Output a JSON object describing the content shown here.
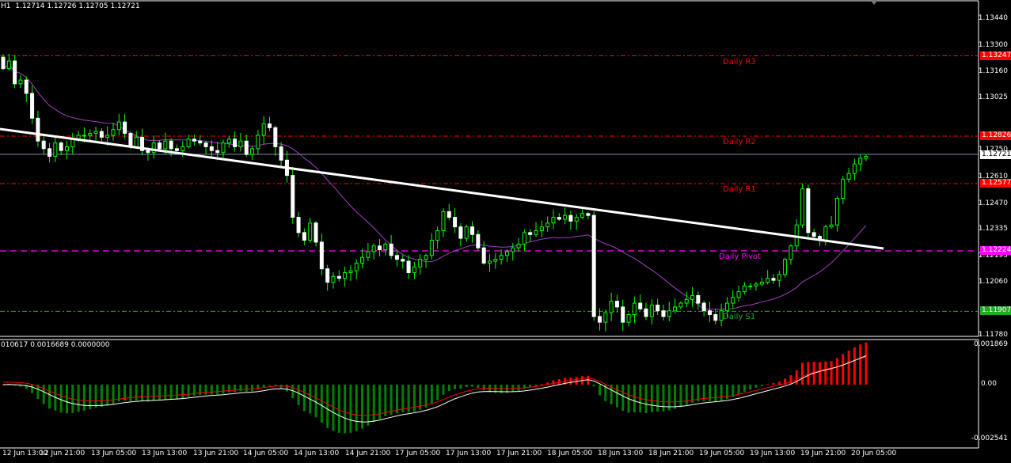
{
  "header": {
    "symbol_tf": "H1",
    "ohlc": "1.12714 1.12726 1.12705 1.12721"
  },
  "indicator": {
    "values": "010617 0.0016689 0.0000000",
    "scale": [
      "0.001869",
      "0.00",
      "-0.002541"
    ]
  },
  "price_scale": [
    "1.13440",
    "1.13300",
    "1.13160",
    "1.13025",
    "1.12750",
    "1.12610",
    "1.12470",
    "1.12335",
    "1.12195",
    "1.12060",
    "1.11780"
  ],
  "levels": [
    {
      "name": "Daily R3",
      "price": 1.13247,
      "badge": "1.13247",
      "color": "#ff0000"
    },
    {
      "name": "Daily R2",
      "price": 1.12826,
      "badge": "1.12826",
      "color": "#ff0000"
    },
    {
      "name": "Daily R1",
      "price": 1.12577,
      "badge": "1.12577",
      "color": "#ff0000"
    },
    {
      "name": "Daily Pivot",
      "price": 1.12224,
      "badge": "1.12224",
      "color": "#ff00ff"
    },
    {
      "name": "Daily S1",
      "price": 1.11907,
      "badge": "1.11907",
      "color": "#22aa22"
    }
  ],
  "current_price": "1.12721",
  "time_axis": [
    "12 Jun 13:00",
    "12 Jun 21:00",
    "13 Jun 05:00",
    "13 Jun 13:00",
    "13 Jun 21:00",
    "14 Jun 05:00",
    "14 Jun 13:00",
    "14 Jun 21:00",
    "17 Jun 05:00",
    "17 Jun 13:00",
    "17 Jun 21:00",
    "18 Jun 05:00",
    "18 Jun 13:00",
    "18 Jun 21:00",
    "19 Jun 05:00",
    "19 Jun 13:00",
    "19 Jun 21:00",
    "20 Jun 05:00"
  ],
  "colors": {
    "bull": "#00ff00",
    "bear": "#ffffff",
    "ma": "#a040c0",
    "trendline": "#ffffff",
    "hist_up": "#ff0000",
    "hist_down": "#008000",
    "signal": "#ff0000",
    "main": "#ffffff"
  },
  "chart_data": {
    "type": "candlestick",
    "candle_closes": [
      1.1318,
      1.1322,
      1.131,
      1.1312,
      1.1305,
      1.1292,
      1.128,
      1.1276,
      1.1272,
      1.1279,
      1.1275,
      1.1277,
      1.1281,
      1.1283,
      1.1283,
      1.1284,
      1.1285,
      1.1282,
      1.1283,
      1.1286,
      1.129,
      1.1284,
      1.1277,
      1.1282,
      1.1275,
      1.1274,
      1.1279,
      1.1276,
      1.128,
      1.1276,
      1.1275,
      1.1277,
      1.1281,
      1.128,
      1.1279,
      1.1277,
      1.1275,
      1.1274,
      1.1279,
      1.1281,
      1.1277,
      1.128,
      1.1273,
      1.1276,
      1.1283,
      1.1289,
      1.1287,
      1.1277,
      1.127,
      1.1262,
      1.124,
      1.1232,
      1.1228,
      1.1237,
      1.1227,
      1.1213,
      1.1206,
      1.1209,
      1.1208,
      1.1211,
      1.1212,
      1.1216,
      1.1219,
      1.1222,
      1.1225,
      1.1223,
      1.1226,
      1.122,
      1.1218,
      1.1217,
      1.1211,
      1.1214,
      1.1218,
      1.122,
      1.1228,
      1.1233,
      1.1243,
      1.124,
      1.1235,
      1.1229,
      1.1235,
      1.1231,
      1.1224,
      1.1216,
      1.1217,
      1.1218,
      1.122,
      1.1222,
      1.1224,
      1.1226,
      1.1232,
      1.1231,
      1.1233,
      1.1235,
      1.1237,
      1.124,
      1.1239,
      1.1241,
      1.1238,
      1.124,
      1.1242,
      1.1241,
      1.1188,
      1.1185,
      1.119,
      1.1196,
      1.1193,
      1.1185,
      1.1189,
      1.1195,
      1.1192,
      1.1188,
      1.1194,
      1.1191,
      1.1188,
      1.1191,
      1.1193,
      1.1195,
      1.1197,
      1.1199,
      1.1195,
      1.1191,
      1.1189,
      1.1186,
      1.1191,
      1.1195,
      1.1198,
      1.1201,
      1.1204,
      1.1204,
      1.1205,
      1.1206,
      1.1208,
      1.1207,
      1.121,
      1.1218,
      1.1225,
      1.1236,
      1.1255,
      1.1232,
      1.123,
      1.1228,
      1.1235,
      1.1236,
      1.125,
      1.126,
      1.1263,
      1.1268,
      1.1271,
      1.1272
    ]
  }
}
